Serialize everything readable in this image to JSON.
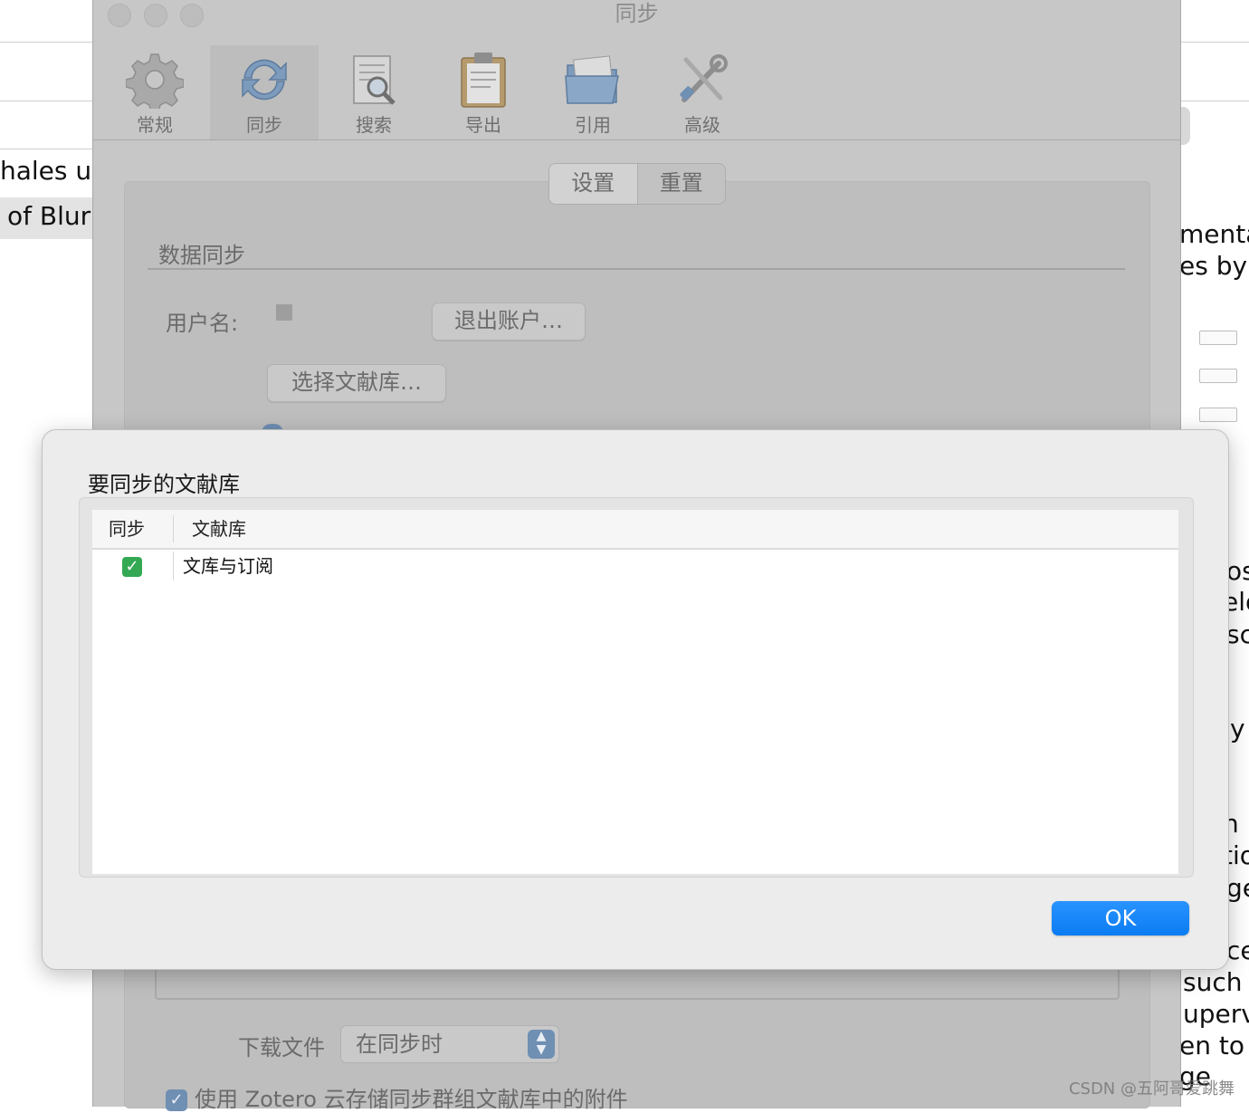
{
  "background_app": {
    "left_lines": [
      "hales us",
      "of Blur"
    ],
    "right_lines": [
      "menta",
      "es by E",
      "os",
      "elo",
      "sca",
      "y",
      "n i",
      "tio",
      "ge",
      "ce",
      "such",
      "uperv",
      "en to b",
      "ge"
    ]
  },
  "window": {
    "title": "同步",
    "toolbar": [
      {
        "label": "常规",
        "icon": "gear-icon"
      },
      {
        "label": "同步",
        "icon": "sync-icon"
      },
      {
        "label": "搜索",
        "icon": "search-document-icon"
      },
      {
        "label": "导出",
        "icon": "clipboard-icon"
      },
      {
        "label": "引用",
        "icon": "folder-icon"
      },
      {
        "label": "高级",
        "icon": "tools-icon"
      }
    ],
    "tabs": {
      "settings": "设置",
      "reset": "重置"
    },
    "section_title": "数据同步",
    "username_label": "用户名:",
    "logout_button": "退出账户…",
    "choose_library_button": "选择文献库…",
    "download_label": "下载文件",
    "download_option": "在同步时",
    "group_checkbox": "使用 Zotero 云存储同步群组文献库中的附件"
  },
  "dialog": {
    "title": "要同步的文献库",
    "columns": [
      "同步",
      "文献库"
    ],
    "rows": [
      {
        "sync": true,
        "library": "文库与订阅"
      }
    ],
    "ok_button": "OK"
  },
  "watermark": "CSDN @五阿哥爱跳舞",
  "colors": {
    "accent": "#0a7cf2",
    "check": "#34a853"
  }
}
